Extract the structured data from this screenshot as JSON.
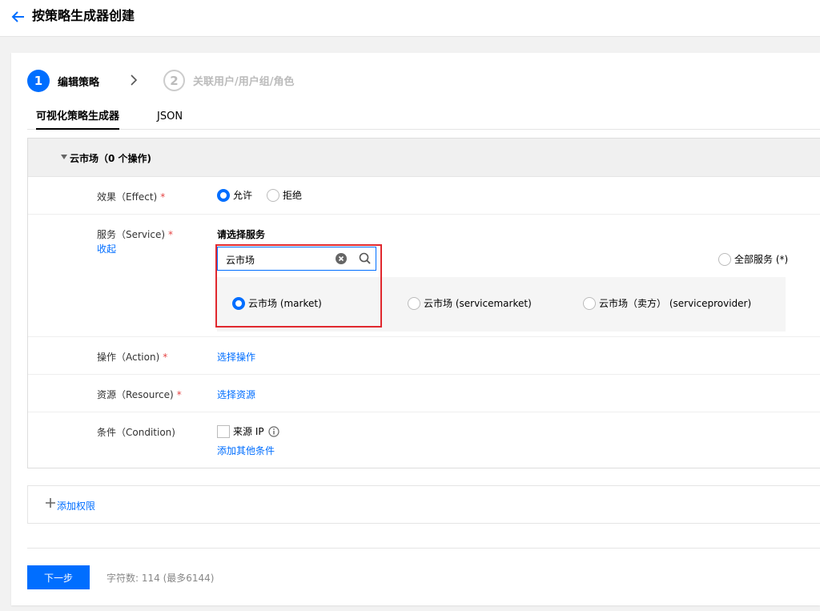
{
  "header": {
    "title": "按策略生成器创建"
  },
  "steps": [
    {
      "num": "1",
      "label": "编辑策略"
    },
    {
      "num": "2",
      "label": "关联用户/用户组/角色"
    }
  ],
  "tabs": [
    {
      "label": "可视化策略生成器"
    },
    {
      "label": "JSON"
    }
  ],
  "section": {
    "title": "云市场（0 个操作)"
  },
  "effect": {
    "label": "效果（Effect)",
    "required": "*",
    "allow": "允许",
    "deny": "拒绝",
    "selected": "允许"
  },
  "service": {
    "label": "服务（Service)",
    "required": "*",
    "collapse": "收起",
    "prompt": "请选择服务",
    "search_value": "云市场",
    "all_services": "全部服务 (*)",
    "options": [
      {
        "label": "云市场 (market)"
      },
      {
        "label": "云市场 (servicemarket)"
      },
      {
        "label": "云市场（卖方） (serviceprovider)"
      }
    ],
    "selected": "云市场 (market)"
  },
  "action": {
    "label": "操作（Action)",
    "required": "*",
    "link": "选择操作"
  },
  "resource": {
    "label": "资源（Resource)",
    "required": "*",
    "link": "选择资源"
  },
  "condition": {
    "label": "条件（Condition)",
    "checkbox": "来源 IP",
    "add": "添加其他条件"
  },
  "add_permission": "添加权限",
  "footer": {
    "next": "下一步",
    "char_count": "字符数: 114 (最多6144)"
  },
  "colors": {
    "accent": "#006eff",
    "highlight": "#e0282e",
    "required": "#e54545"
  }
}
